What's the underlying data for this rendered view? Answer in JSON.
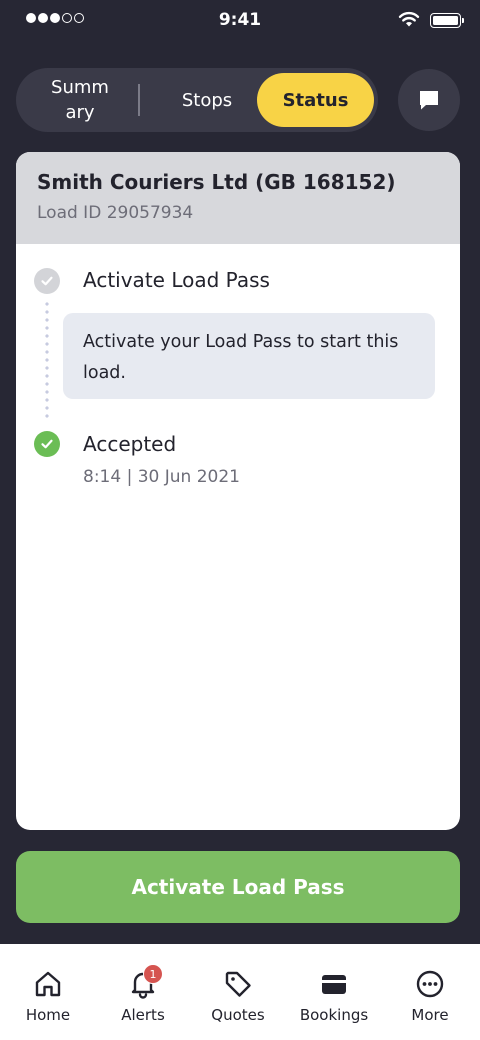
{
  "status_bar": {
    "time": "9:41"
  },
  "segments": {
    "summary": "Summ\nary",
    "stops": "Stops",
    "status": "Status",
    "active": "status"
  },
  "card": {
    "company": "Smith Couriers Ltd (GB 168152)",
    "load_id": "Load ID 29057934",
    "steps": [
      {
        "title": "Activate Load Pass",
        "state": "pending",
        "note": "Activate your Load Pass to start this load."
      },
      {
        "title": "Accepted",
        "state": "done",
        "time": "8:14 | 30 Jun 2021"
      }
    ]
  },
  "action": {
    "label": "Activate Load Pass"
  },
  "tabbar": {
    "items": [
      {
        "label": "Home",
        "icon": "home-icon"
      },
      {
        "label": "Alerts",
        "icon": "bell-icon",
        "badge": "1"
      },
      {
        "label": "Quotes",
        "icon": "tag-icon"
      },
      {
        "label": "Bookings",
        "icon": "wallet-icon"
      },
      {
        "label": "More",
        "icon": "more-icon"
      }
    ]
  },
  "colors": {
    "background": "#272734",
    "accent_yellow": "#f8d346",
    "action_green": "#7dbd63",
    "done_green": "#6bbd55",
    "badge_red": "#d55450"
  }
}
